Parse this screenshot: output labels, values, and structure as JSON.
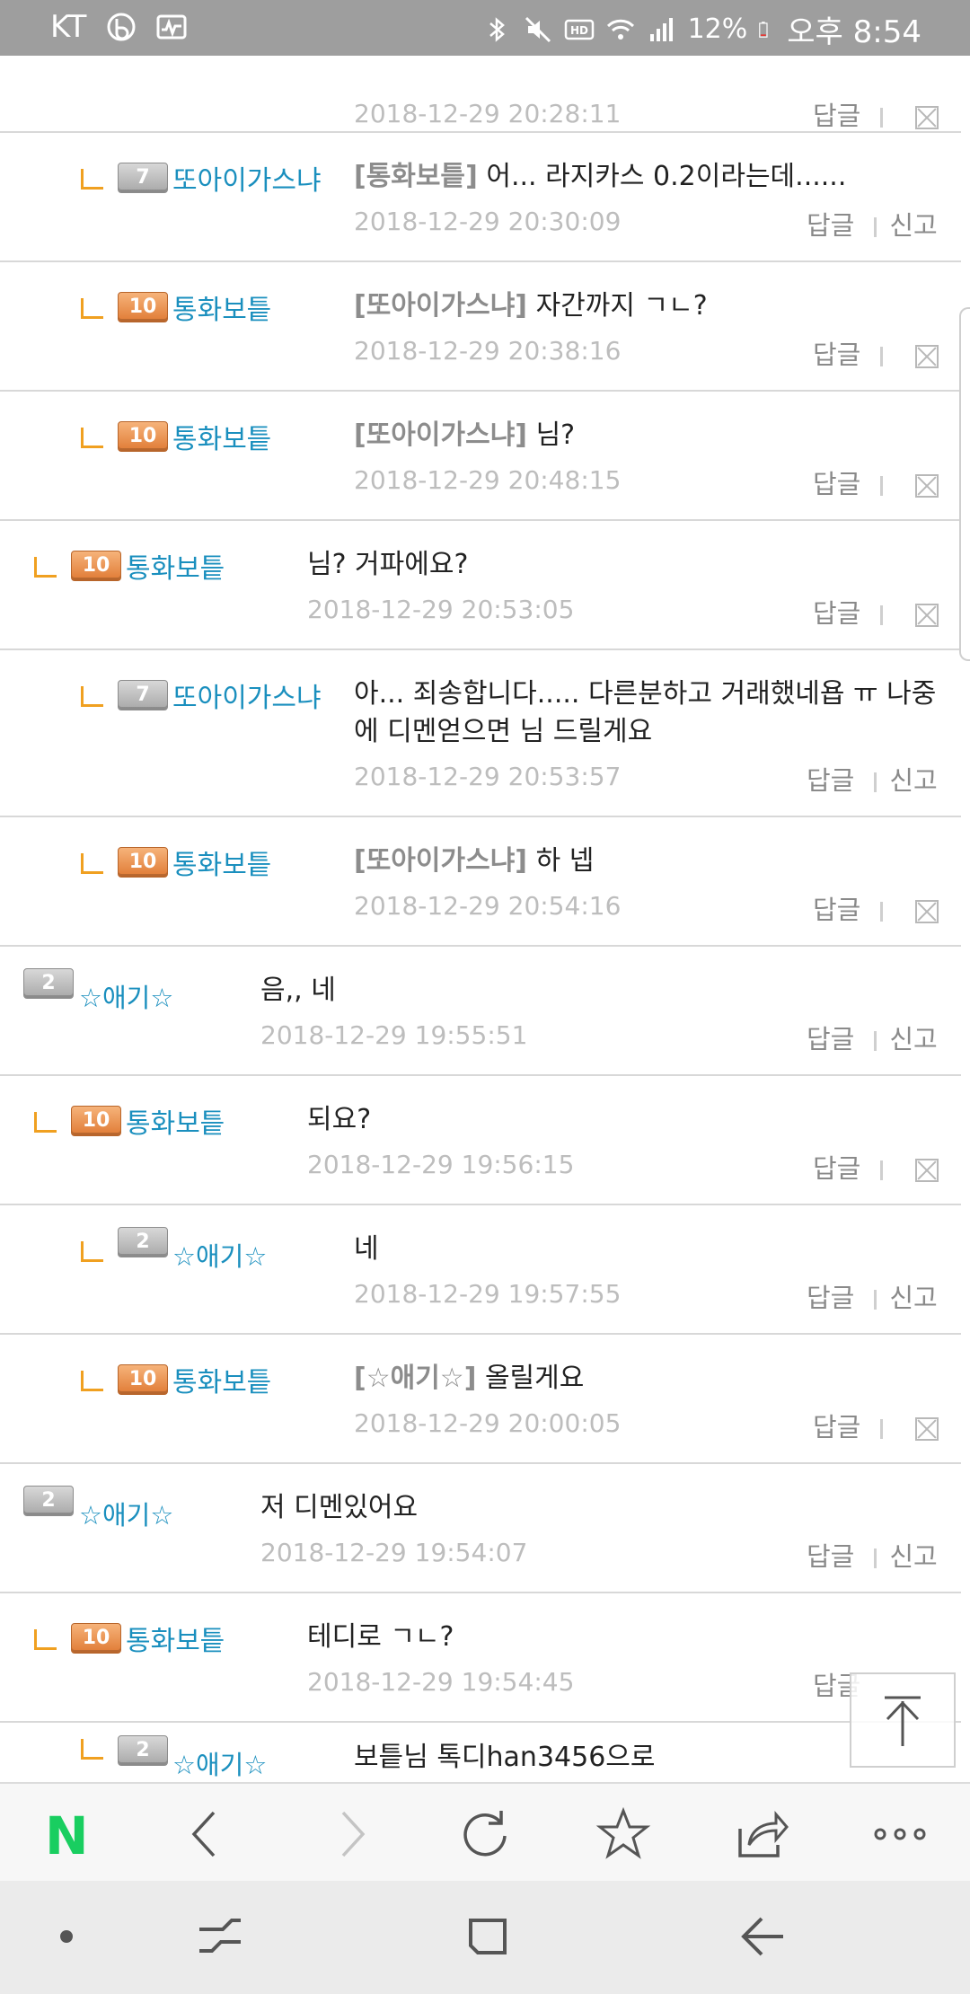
{
  "status_bar": {
    "carrier": "KT",
    "battery_percent": "12%",
    "time": "오후 8:54",
    "icons": [
      "b-icon",
      "activity-icon",
      "bluetooth-icon",
      "mute-icon",
      "hd-icon",
      "wifi-icon",
      "signal-icon",
      "battery-icon"
    ]
  },
  "comments": [
    {
      "level": "",
      "nick": "",
      "text": "",
      "mention": "",
      "date": "2018-12-29 20:28:11",
      "reply": "답글",
      "action": "delete"
    },
    {
      "level": "7",
      "nick": "또아이가스냐",
      "mention": "[통화보틑]",
      "text": " 어... 라지카스 0.2이라는데......",
      "date": "2018-12-29 20:30:09",
      "reply": "답글",
      "report": "신고"
    },
    {
      "level": "10",
      "nick": "통화보틑",
      "mention": "[또아이가스냐]",
      "text": " 자간까지 ㄱㄴ?",
      "date": "2018-12-29 20:38:16",
      "reply": "답글"
    },
    {
      "level": "10",
      "nick": "통화보틑",
      "mention": "[또아이가스냐]",
      "text": " 님?",
      "date": "2018-12-29 20:48:15",
      "reply": "답글"
    },
    {
      "level": "10",
      "nick": "통화보틑",
      "mention": "",
      "text": "님? 거파에요?",
      "date": "2018-12-29 20:53:05",
      "reply": "답글"
    },
    {
      "level": "7",
      "nick": "또아이가스냐",
      "mention": "",
      "text": "아... 죄송합니다..... 다른분하고 거래했네욥 ㅠ 나중에 디멘얻으면 님 드릴게요",
      "date": "2018-12-29 20:53:57",
      "reply": "답글",
      "report": "신고"
    },
    {
      "level": "10",
      "nick": "통화보틑",
      "mention": "[또아이가스냐]",
      "text": " 하 넵",
      "date": "2018-12-29 20:54:16",
      "reply": "답글"
    },
    {
      "level": "2",
      "nick": "☆애기☆",
      "mention": "",
      "text": "음,, 네",
      "date": "2018-12-29 19:55:51",
      "reply": "답글",
      "report": "신고"
    },
    {
      "level": "10",
      "nick": "통화보틑",
      "mention": "",
      "text": "되요?",
      "date": "2018-12-29 19:56:15",
      "reply": "답글"
    },
    {
      "level": "2",
      "nick": "☆애기☆",
      "mention": "",
      "text": "네",
      "date": "2018-12-29 19:57:55",
      "reply": "답글",
      "report": "신고"
    },
    {
      "level": "10",
      "nick": "통화보틑",
      "mention": "[☆애기☆]",
      "text": " 올릴게요",
      "date": "2018-12-29 20:00:05",
      "reply": "답글"
    },
    {
      "level": "2",
      "nick": "☆애기☆",
      "mention": "",
      "text": "저 디멘있어요",
      "date": "2018-12-29 19:54:07",
      "reply": "답글",
      "report": "신고"
    },
    {
      "level": "10",
      "nick": "통화보틑",
      "mention": "",
      "text": "테디로 ㄱㄴ?",
      "date": "2018-12-29 19:54:45",
      "reply": "답글"
    },
    {
      "level": "2",
      "nick": "☆애기☆",
      "mention": "",
      "text": "보틑님 톡디han3456으로",
      "date": "",
      "reply": ""
    }
  ],
  "colors": {
    "nick": "#1a8fbe",
    "reply_mark": "#f0a020",
    "naver_green": "#19ce60",
    "status_bar": "#9e9e9e"
  },
  "toolbar": {
    "logo": "N",
    "icons": [
      "naver-logo",
      "back-icon",
      "forward-icon",
      "refresh-icon",
      "bookmark-star-icon",
      "share-icon",
      "more-icon"
    ]
  },
  "navbar": {
    "icons": [
      "dot-icon",
      "recent-apps-icon",
      "home-icon",
      "back-nav-icon"
    ]
  }
}
